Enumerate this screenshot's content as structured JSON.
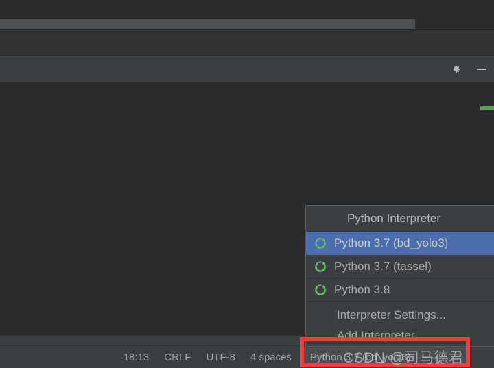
{
  "window": {
    "theme_bg": "#2b2b2b",
    "panel_bg": "#3c3f41",
    "accent_selection": "#4b6eaf",
    "marker_green": "#5d9e5d",
    "annotation_red": "#f03c3c"
  },
  "toolbar": {
    "settings_icon": "gear-icon",
    "minimize_icon": "minimize-icon"
  },
  "editor": {
    "inspection_marker": "green-inspection-marker"
  },
  "status_bar": {
    "items": [
      {
        "label": "18:13",
        "name": "caret-position"
      },
      {
        "label": "CRLF",
        "name": "line-separator"
      },
      {
        "label": "UTF-8",
        "name": "file-encoding"
      },
      {
        "label": "4 spaces",
        "name": "indent-size"
      }
    ],
    "interpreter": {
      "label": "Python 3.7 (bd_yolo3)",
      "name": "python-interpreter-widget"
    }
  },
  "popup": {
    "title": "Python Interpreter",
    "interpreters": [
      {
        "label": "Python 3.7 (bd_yolo3)",
        "selected": true,
        "icon": "python-spinner-icon"
      },
      {
        "label": "Python 3.7 (tassel)",
        "selected": false,
        "icon": "python-spinner-icon"
      },
      {
        "label": "Python 3.8",
        "selected": false,
        "icon": "python-spinner-icon"
      }
    ],
    "actions": [
      {
        "label": "Interpreter Settings...",
        "name": "interpreter-settings-action"
      },
      {
        "label": "Add Interpreter...",
        "name": "add-interpreter-action"
      }
    ]
  },
  "watermark": {
    "text": "CSDN @司马德君"
  }
}
